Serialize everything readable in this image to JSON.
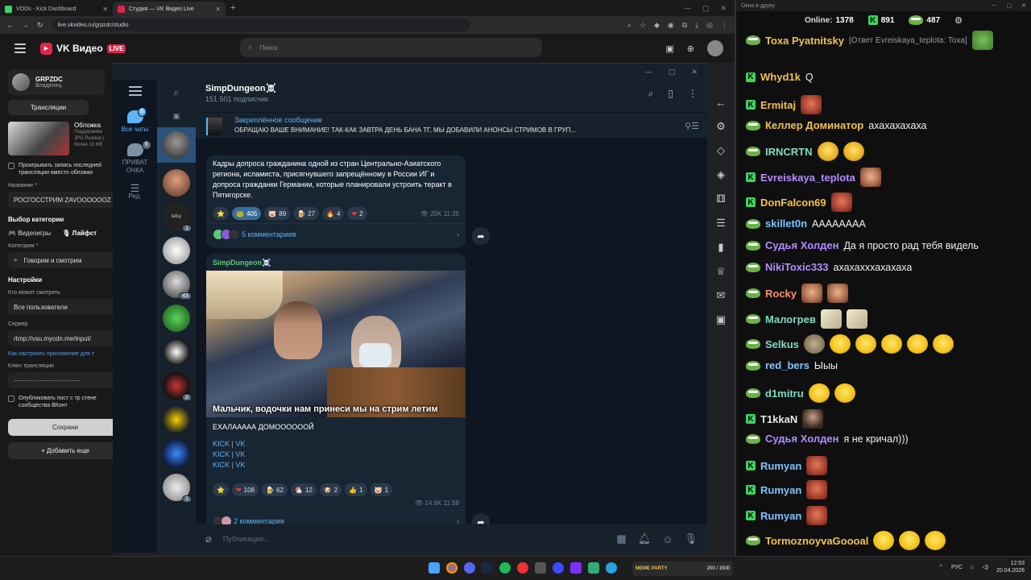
{
  "browser": {
    "tabs": [
      {
        "label": "VODs - Kick Dashboard",
        "color": "#3fd35f",
        "active": false
      },
      {
        "label": "Студия — VK Видео Live",
        "color": "#e0244a",
        "active": true
      }
    ],
    "url": "live.vkvideo.ru/grpzdc/studio"
  },
  "vk": {
    "logo_text": "VK Видео",
    "live_badge": "LIVE",
    "search_placeholder": "Поиск",
    "right_cut": "чики",
    "channel_name": "GRPZDC",
    "channel_role": "Владелец",
    "tab_broadcasts": "Трансляции",
    "cover_title": "Обложка",
    "cover_hint_1": "Поддержива",
    "cover_hint_2": "JPG Размер (",
    "cover_hint_3": "более 10 Мб",
    "record_label": "Проигрывать запись последней трансляции вместо обложки",
    "name_label": "Название *",
    "name_value": "РОСГОССТРИМ ZAVOOOOOOZ",
    "category_section": "Выбор категории",
    "cat_games": "Видеоигры",
    "cat_life": "Лайфст",
    "category_label": "Категория *",
    "category_value": "Говорим и смотрим",
    "settings_section": "Настройки",
    "who_label": "Кто может смотреть",
    "who_value": "Все пользователи",
    "server_label": "Сервер",
    "server_value": "rtmp://vsu.mycdn.me/input/",
    "setup_link": "Как настроить приложение для т",
    "key_label": "Ключ трансляции",
    "key_value": "·······························",
    "publish_label": "Опубликовать пост с тр стене сообщества ВКонт",
    "save_button": "Сохрани",
    "add_button": "Добавить еще"
  },
  "telegram": {
    "folders": [
      {
        "label": "Все чаты",
        "badge": "6",
        "active": true
      },
      {
        "label": "ПРИВАТ ОЧКА",
        "badge": "6",
        "active": false
      },
      {
        "label": "Ред.",
        "badge": "",
        "active": false
      }
    ],
    "chat_badges": {
      "c3": "1",
      "c5": "43",
      "c8": "2",
      "c11": "1"
    },
    "chat_label_c3": "tеlsy",
    "channel": "SimpDungeon☠️",
    "subscribers": "151 501 подписчик",
    "pinned_title": "Закреплённое сообщение",
    "pinned_text": "ОБРАЩАЮ ВАШЕ ВНИМАНИЕ! ТАК-КАК ЗАВТРА ДЕНЬ БАНА ТГ, МЫ ДОБАВИЛИ АНОНСЫ СТРИМОВ В ГРУП...",
    "post1": {
      "text": "Кадры допроса гражданина одной из стран Центрально-Азиатского региона, исламиста, присягнувшего запрещённому в России ИГ и допроса гражданки Германии, которые планировали устроить теракт в Пятигорске.",
      "reactions": [
        {
          "icon": "⭐",
          "count": ""
        },
        {
          "icon": "🐸",
          "count": "405",
          "selected": true
        },
        {
          "icon": "🐷",
          "count": "89"
        },
        {
          "icon": "🍺",
          "count": "27"
        },
        {
          "icon": "🔥",
          "count": "4"
        },
        {
          "icon": "❤",
          "count": "2"
        }
      ],
      "views": "20K",
      "time": "11:35",
      "comments": "5 комментариев"
    },
    "post2": {
      "author": "SimpDungeon☠️",
      "caption": "Мальчик, водочки нам принеси  мы на стрим летим",
      "text": "ЕХАЛААААА ДОМООООООЙ",
      "links": [
        "KICK",
        "VK",
        "KICK",
        "VK",
        "KICK",
        "VK"
      ],
      "link_sep": "|",
      "reactions": [
        {
          "icon": "⭐",
          "count": ""
        },
        {
          "icon": "❤",
          "count": "108"
        },
        {
          "icon": "🍺",
          "count": "62"
        },
        {
          "icon": "🐔",
          "count": "12"
        },
        {
          "icon": "🐶",
          "count": "2"
        },
        {
          "icon": "👍",
          "count": "1"
        },
        {
          "icon": "🐷",
          "count": "1"
        }
      ],
      "views": "14.6K",
      "time": "11:58",
      "comments": "2 комментария"
    },
    "compose_placeholder": "Публикация..."
  },
  "chat": {
    "window_title": "Окно в друку",
    "online_label": "Online:",
    "online_count": "1378",
    "kick_count": "891",
    "vk_count": "487",
    "messages": [
      {
        "user": "Toxa Pyatnitsky",
        "color": "#f2c14e",
        "reply": "[Ответ Evreiskaya_teplota: Toxa]",
        "text": "",
        "platform": "vk",
        "emotes": [
          "frog"
        ]
      },
      {
        "user": "Whyd1k",
        "color": "#f2c14e",
        "text": "Q",
        "platform": "kick",
        "emotes": []
      },
      {
        "user": "Ermitaj",
        "color": "#f2c14e",
        "text": "",
        "platform": "kick",
        "emotes": [
          "red"
        ]
      },
      {
        "user": "Келлер Доминатор",
        "color": "#f2c14e",
        "text": "ахахахахаха",
        "platform": "vk",
        "emotes": []
      },
      {
        "user": "IRNCRTN",
        "color": "#7fdcc3",
        "text": "",
        "platform": "vk",
        "emotes": [
          "yel",
          "yel"
        ]
      },
      {
        "user": "Evreiskaya_teplota",
        "color": "#b48cff",
        "text": "",
        "platform": "kick",
        "emotes": [
          "face"
        ]
      },
      {
        "user": "DonFalcon69",
        "color": "#f2c14e",
        "text": "",
        "platform": "kick",
        "emotes": [
          "red"
        ]
      },
      {
        "user": "skillet0n",
        "color": "#7fc3ff",
        "text": "AAAAAAAA",
        "platform": "vk",
        "emotes": []
      },
      {
        "user": "Судья Холден",
        "color": "#b48cff",
        "text": "Да я просто рад тебя видель",
        "platform": "vk",
        "emotes": []
      },
      {
        "user": "NikiToxic333",
        "color": "#b48cff",
        "text": "ахахахххахахаха",
        "platform": "vk",
        "emotes": []
      },
      {
        "user": "Rocky",
        "color": "#ff8f6b",
        "text": "",
        "platform": "vk",
        "emotes": [
          "face",
          "face"
        ]
      },
      {
        "user": "Малогрев",
        "color": "#7fdcc3",
        "text": "",
        "platform": "vk",
        "emotes": [
          "beige",
          "beige"
        ]
      },
      {
        "user": "Selkus",
        "color": "#7fdcc3",
        "text": "",
        "platform": "vk",
        "emotes": [
          "stone",
          "lol",
          "lol",
          "lol",
          "lol",
          "lol"
        ]
      },
      {
        "user": "red_bers",
        "color": "#7fc3ff",
        "text": "Ыыы",
        "platform": "vk",
        "emotes": []
      },
      {
        "user": "d1mitru",
        "color": "#7fdcc3",
        "text": "",
        "platform": "vk",
        "emotes": [
          "lol",
          "lol"
        ]
      },
      {
        "user": "T1kkaN",
        "color": "#e6e6e6",
        "text": "",
        "platform": "kick",
        "emotes": [
          "dark"
        ]
      },
      {
        "user": "Судья Холден",
        "color": "#b48cff",
        "text": "я не кричал)))",
        "platform": "vk",
        "emotes": []
      },
      {
        "user": "Rumyan",
        "color": "#7fc3ff",
        "text": "",
        "platform": "kick",
        "emotes": [
          "red"
        ]
      },
      {
        "user": "Rumyan",
        "color": "#7fc3ff",
        "text": "",
        "platform": "kick",
        "emotes": [
          "red"
        ]
      },
      {
        "user": "Rumyan",
        "color": "#7fc3ff",
        "text": "",
        "platform": "kick",
        "emotes": [
          "red"
        ]
      },
      {
        "user": "TormoznoyvaGoooal",
        "color": "#f2c14e",
        "text": "",
        "platform": "vk",
        "emotes": [
          "lol",
          "lol",
          "lol"
        ]
      }
    ]
  },
  "taskbar": {
    "notif_title": "MEME PARTY",
    "notif_progress": "200 / 1500",
    "lang": "РУС",
    "time": "12:53",
    "date": "20.04.2026"
  }
}
